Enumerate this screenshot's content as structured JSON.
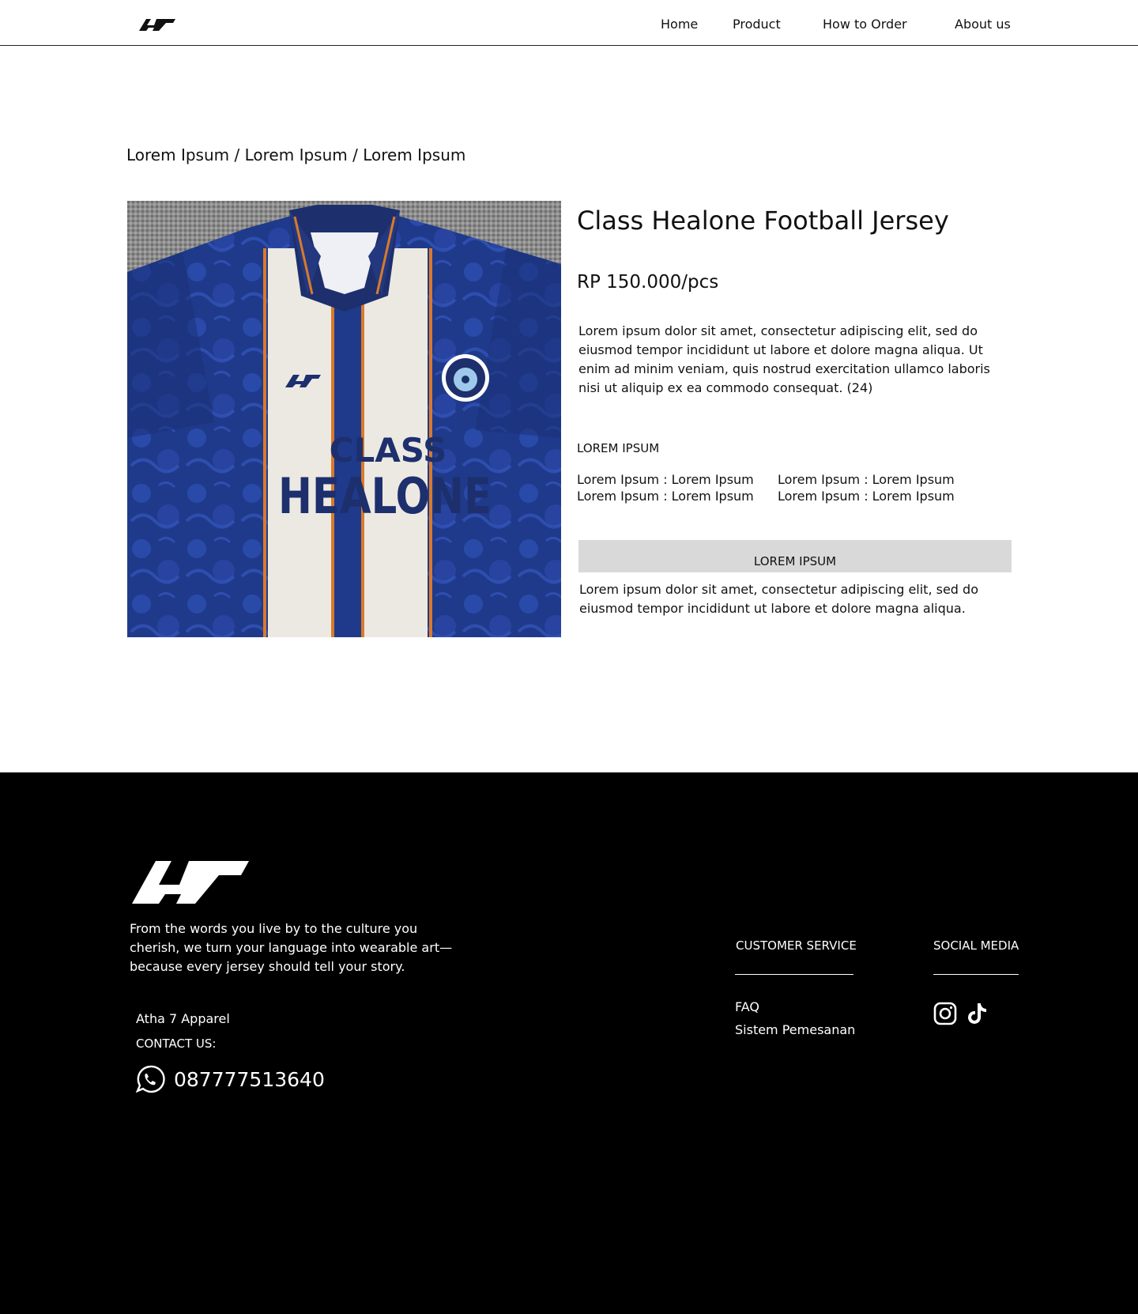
{
  "nav": {
    "logo": "atha7-logo",
    "links": [
      "Home",
      "Product",
      "How to Order",
      "About us"
    ]
  },
  "breadcrumb": {
    "items": [
      "Lorem Ipsum",
      "Lorem Ipsum",
      "Lorem Ipsum"
    ],
    "separator": "/"
  },
  "product": {
    "image": {
      "description": "",
      "jersey_text_line1": "CLASS",
      "jersey_text_line2": "HEALONE"
    },
    "title": "Class Healone Football Jersey",
    "price": "RP 150.000/pcs",
    "description": "Lorem ipsum dolor sit amet, consectetur adipiscing elit, sed do eiusmod tempor incididunt ut labore et dolore magna aliqua. Ut enim ad minim veniam, quis nostrud exercitation ullamco laboris nisi ut aliquip ex ea commodo consequat. (24)",
    "spec_heading": "LOREM IPSUM",
    "specs": [
      "Lorem Ipsum : Lorem Ipsum",
      "Lorem Ipsum : Lorem Ipsum",
      "Lorem Ipsum : Lorem Ipsum",
      "Lorem Ipsum : Lorem Ipsum"
    ],
    "button_label": "LOREM IPSUM",
    "note": "Lorem ipsum dolor sit amet, consectetur adipiscing elit, sed do eiusmod tempor incididunt ut labore et dolore magna aliqua."
  },
  "footer": {
    "logo": "atha7-logo",
    "tagline": "From the words you live by to the culture you cherish, we turn your language into wearable art—because every jersey should tell your story.",
    "company": "Atha 7 Apparel",
    "contact_label": "CONTACT US:",
    "phone": "087777513640",
    "customer_service": {
      "heading": "CUSTOMER SERVICE",
      "links": [
        "FAQ",
        "Sistem Pemesanan"
      ]
    },
    "social_media": {
      "heading": "SOCIAL MEDIA",
      "icons": [
        "instagram-icon",
        "tiktok-icon"
      ]
    }
  },
  "colors": {
    "footer_bg": "#000000",
    "button_bg": "#d9d9d9",
    "jersey_navy": "#1f3a8a",
    "jersey_white": "#ece9e2",
    "jersey_orange": "#d97a2b"
  }
}
